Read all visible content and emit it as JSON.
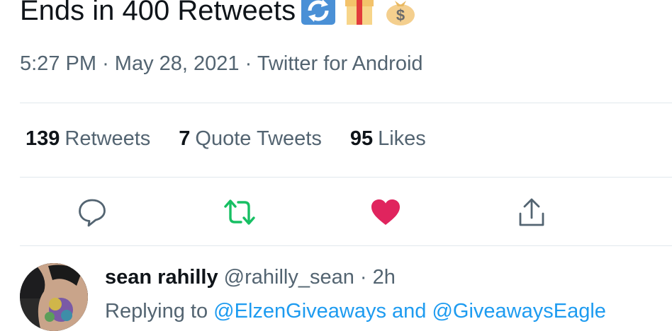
{
  "tweet": {
    "text": "Ends in 400 Retweets",
    "emojis": [
      "counterclockwise-arrows-emoji",
      "gift-emoji",
      "money-bag-emoji"
    ]
  },
  "meta": {
    "time": "5:27 PM",
    "sep1": "·",
    "date": "May 28, 2021",
    "sep2": "·",
    "source": "Twitter for Android"
  },
  "stats": {
    "retweets_count": "139",
    "retweets_label": "Retweets",
    "quotes_count": "7",
    "quotes_label": "Quote Tweets",
    "likes_count": "95",
    "likes_label": "Likes"
  },
  "actions": {
    "icons": [
      "reply-icon",
      "retweet-icon",
      "like-icon",
      "share-icon"
    ],
    "retweeted": true,
    "liked": true
  },
  "reply": {
    "name": "sean rahilly",
    "handle": "@rahilly_sean",
    "sep": "·",
    "time": "2h",
    "replying_prefix": "Replying to",
    "mention1": "@ElzenGiveaways",
    "and": "and",
    "mention2": "@GiveawaysEagle"
  },
  "colors": {
    "text": "#0f1419",
    "secondary": "#536471",
    "retweet_green": "#17bf63",
    "like_red": "#e0245e",
    "link_blue": "#1d9bf0",
    "divider": "#e1e8ed"
  }
}
